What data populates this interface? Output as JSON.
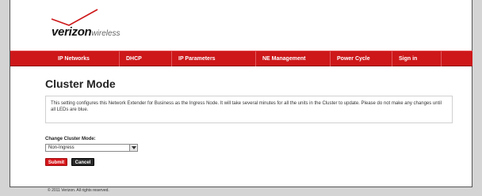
{
  "brand": {
    "logo_bold": "verizon",
    "logo_light": "wireless"
  },
  "nav": {
    "items": [
      {
        "label": "IP Networks"
      },
      {
        "label": "DHCP"
      },
      {
        "label": "IP Parameters"
      },
      {
        "label": "NE Management"
      },
      {
        "label": "Power Cycle"
      },
      {
        "label": "Sign in"
      }
    ]
  },
  "main": {
    "title": "Cluster Mode",
    "description": "This setting configures this Network Extender for Business as the Ingress Node. It will take several minutes for all the units in the Cluster to update. Please do not make any changes until all LEDs are blue.",
    "change_label": "Change Cluster Mode:",
    "select_value": "Non-Ingress",
    "submit_label": "Submit",
    "cancel_label": "Cancel"
  },
  "footer": {
    "copyright": "© 2011 Verizon. All rights reserved."
  },
  "colors": {
    "accent": "#cd1719",
    "cancel": "#2a2a2a"
  }
}
